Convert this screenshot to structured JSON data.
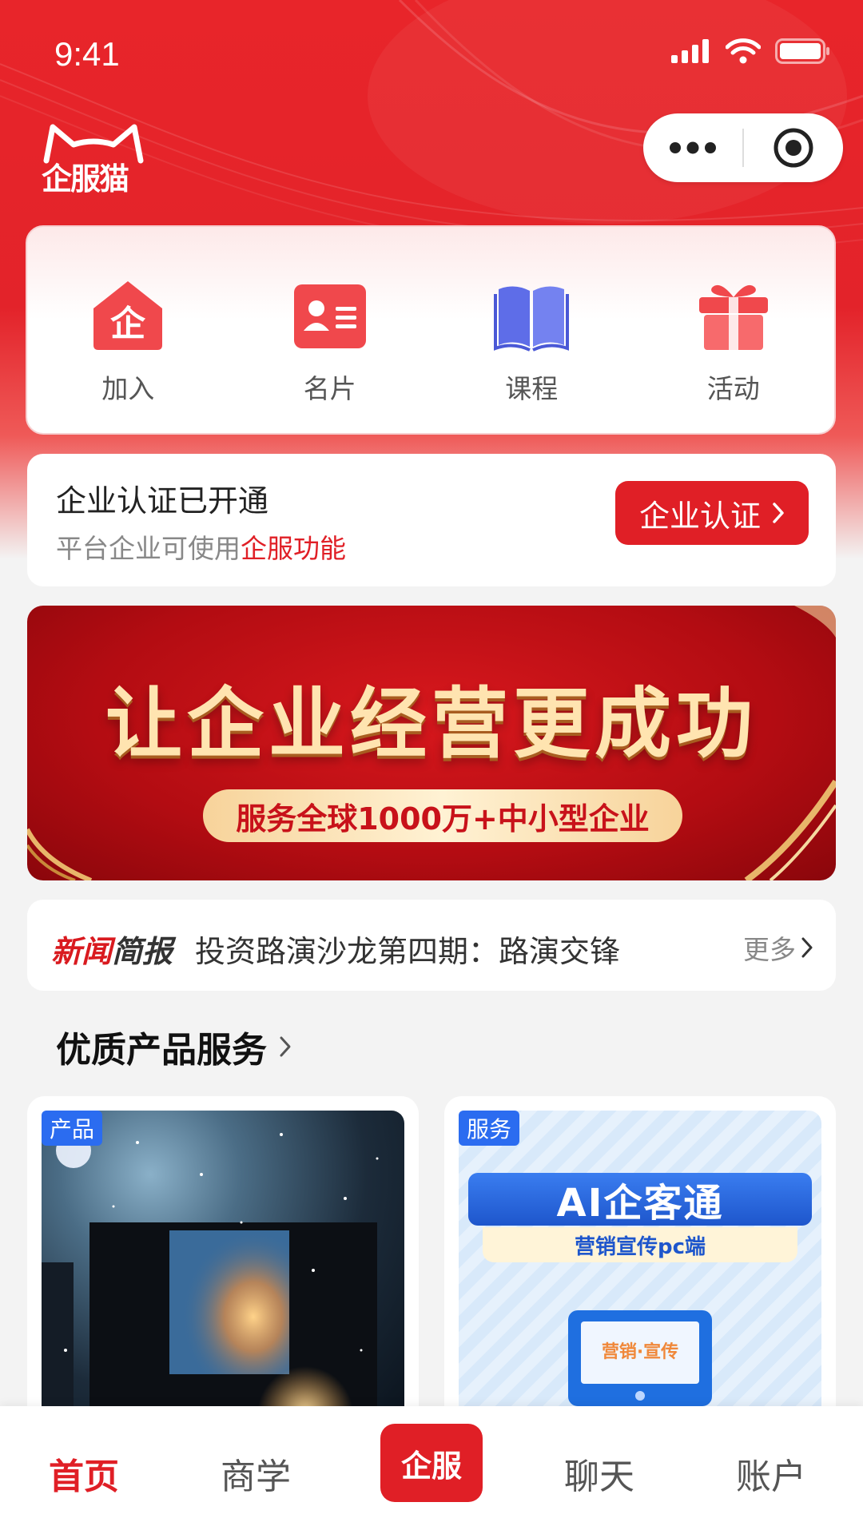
{
  "status_bar": {
    "time": "9:41"
  },
  "header": {
    "logo_text": "企服猫"
  },
  "quick_actions": [
    {
      "label": "加入",
      "icon": "enterprise-house-icon"
    },
    {
      "label": "名片",
      "icon": "business-card-icon"
    },
    {
      "label": "课程",
      "icon": "book-icon"
    },
    {
      "label": "活动",
      "icon": "gift-icon"
    }
  ],
  "cert": {
    "title": "企业认证已开通",
    "subtitle_prefix": "平台企业可使用",
    "subtitle_highlight": "企服功能",
    "button_label": "企业认证"
  },
  "banner": {
    "title": "让企业经营更成功",
    "subtitle": "服务全球1000万+中小型企业"
  },
  "news": {
    "tag_red": "新闻",
    "tag_dark": "简报",
    "headline": "投资路演沙龙第四期：路演交锋",
    "more_label": "更多"
  },
  "section": {
    "title": "优质产品服务"
  },
  "products": [
    {
      "tag": "产品"
    },
    {
      "tag": "服务",
      "poster_title": "AI企客通",
      "poster_sub": "营销宣传pc端",
      "screen_text": "营销·宣传"
    }
  ],
  "tabbar": {
    "home": "首页",
    "business": "商学",
    "service": "企服",
    "chat": "聊天",
    "account": "账户"
  },
  "colors": {
    "brand_red": "#e01f26",
    "tag_blue": "#2b6cf0"
  }
}
